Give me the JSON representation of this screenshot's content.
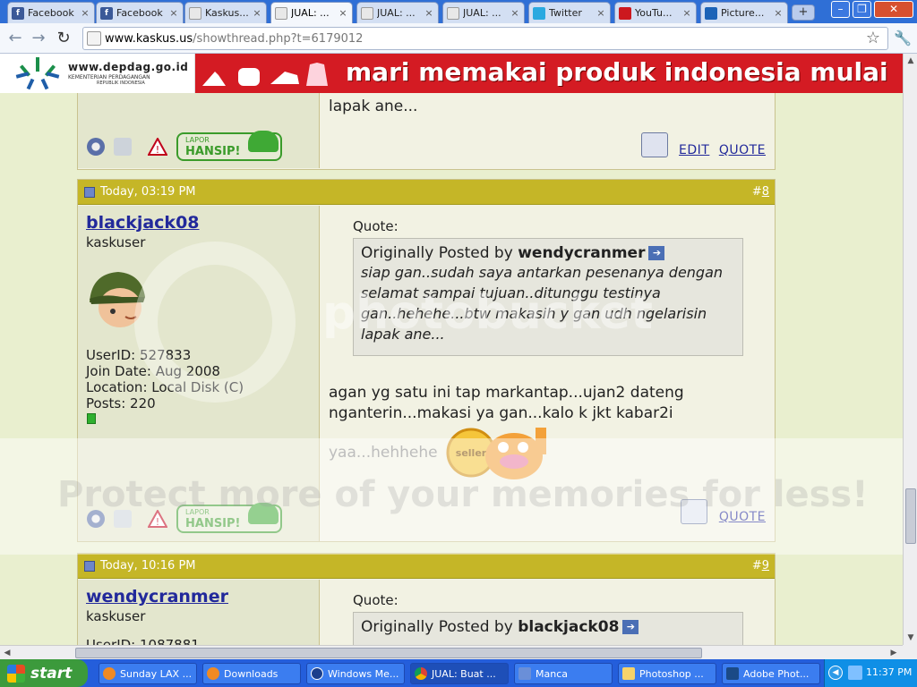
{
  "browser": {
    "tabs": [
      {
        "label": "Facebook",
        "icon": "facebook-icon",
        "active": false
      },
      {
        "label": "Facebook",
        "icon": "facebook-icon",
        "active": false
      },
      {
        "label": "Kaskus...",
        "icon": "kaskus-icon",
        "active": false
      },
      {
        "label": "JUAL: ...",
        "icon": "kaskus-icon",
        "active": true
      },
      {
        "label": "JUAL: ...",
        "icon": "kaskus-icon",
        "active": false
      },
      {
        "label": "JUAL: ...",
        "icon": "kaskus-icon",
        "active": false
      },
      {
        "label": "Twitter",
        "icon": "twitter-icon",
        "active": false
      },
      {
        "label": "YouTu...",
        "icon": "youtube-icon",
        "active": false
      },
      {
        "label": "Picture...",
        "icon": "photobucket-icon",
        "active": false
      }
    ],
    "new_tab_label": "+",
    "close_glyph": "×",
    "url_host": "www.kaskus.us",
    "url_path": "/showthread.php?t=6179012"
  },
  "banner": {
    "logo_site": "www.depdag.go.id",
    "logo_org": "KEMENTERIAN PERDAGANGAN",
    "logo_country": "REPUBLIK INDONESIA",
    "slogan": "mari memakai produk indonesia mulai"
  },
  "posts": {
    "prev": {
      "tail_text": "lapak ane...",
      "edit_label": "EDIT",
      "quote_label": "QUOTE",
      "report_small": "LAPOR",
      "report_big": "HANSIP!"
    },
    "p8": {
      "date": "Today, 03:19 PM",
      "number_prefix": "#",
      "number": "8",
      "username": "blackjack08",
      "usertitle": "kaskuser",
      "userid_label": "UserID:",
      "userid": "527833",
      "join_label": "Join Date:",
      "join": "Aug 2008",
      "location_label": "Location:",
      "location": "Local Disk (C)",
      "posts_label": "Posts:",
      "posts": "220",
      "quote_label": "Quote:",
      "originally": "Originally Posted by",
      "quoted_user": "wendycranmer",
      "quote_text": "siap gan..sudah saya antarkan pesenanya dengan selamat sampai tujuan..ditunggu testinya gan..hehehe...btw makasih y gan udh ngelarisin lapak ane...",
      "message": "agan yg satu ini tap markantap...ujan2 dateng nganterin...makasi ya gan...kalo k jkt kabar2i",
      "message2": "yaa...hehhehe",
      "seller_badge": "seller",
      "quote_btn": "QUOTE",
      "report_small": "LAPOR",
      "report_big": "HANSIP!"
    },
    "p9": {
      "date": "Today, 10:16 PM",
      "number_prefix": "#",
      "number": "9",
      "username": "wendycranmer",
      "usertitle": "kaskuser",
      "userid_label": "UserID:",
      "userid": "1087881",
      "quote_label": "Quote:",
      "originally": "Originally Posted by",
      "quoted_user": "blackjack08"
    }
  },
  "watermark": {
    "main": "Protect more of your memories for less!",
    "brand": "photobucket"
  },
  "taskbar": {
    "start": "start",
    "tasks": [
      {
        "label": "Sunday LAX ...",
        "active": false
      },
      {
        "label": "Downloads",
        "active": false
      },
      {
        "label": "Windows Me...",
        "active": false
      },
      {
        "label": "JUAL: Buat ...",
        "active": true
      },
      {
        "label": "Manca",
        "active": false
      },
      {
        "label": "Photoshop ...",
        "active": false
      },
      {
        "label": "Adobe Phot...",
        "active": false
      }
    ],
    "clock": "11:37 PM"
  }
}
